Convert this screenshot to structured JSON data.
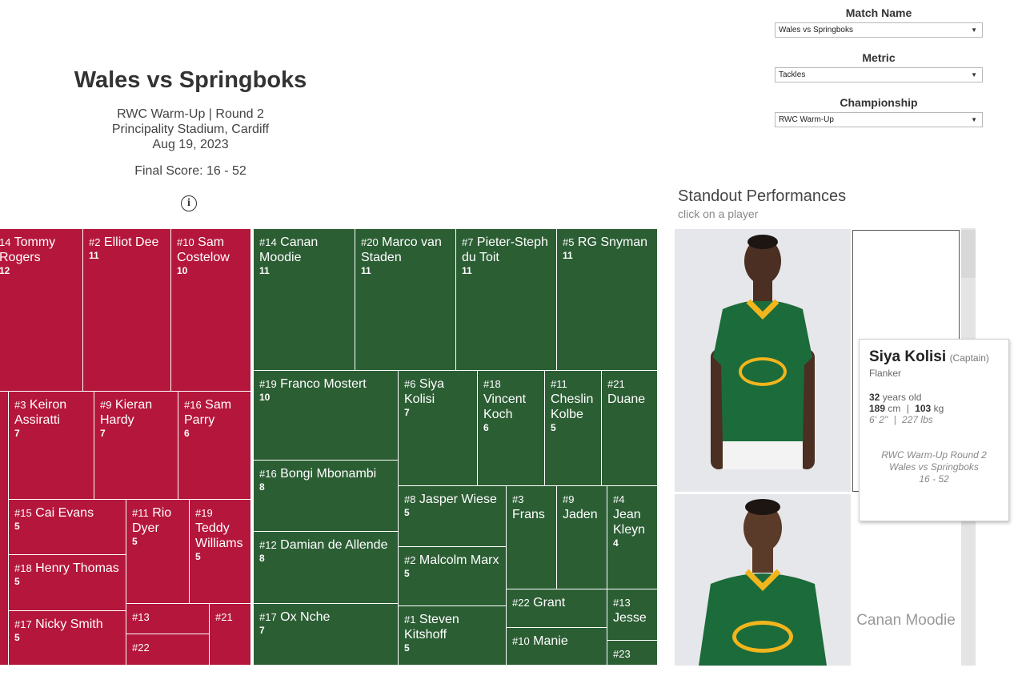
{
  "header": {
    "title": "Wales vs Springboks",
    "competition": "RWC Warm-Up | Round 2",
    "venue": "Principality Stadium, Cardiff",
    "date": "Aug 19, 2023",
    "final_score": "Final Score: 16 - 52",
    "info_icon": "i"
  },
  "filters": {
    "match_name": {
      "label": "Match Name",
      "value": "Wales vs Springboks"
    },
    "metric": {
      "label": "Metric",
      "value": "Tackles"
    },
    "championship": {
      "label": "Championship",
      "value": "RWC Warm-Up"
    }
  },
  "standout": {
    "title": "Standout Performances",
    "subtitle": "click on a player",
    "second_label": "Canan Moodie"
  },
  "colors": {
    "wales": "#b5163b",
    "springboks": "#2c5e34",
    "jersey": "#1c6b3b",
    "collar": "#f2b51c"
  },
  "wales_tiles": [
    {
      "num": "14",
      "name": "Tommy Rogers",
      "value": "12"
    },
    {
      "num": "#2",
      "name": "Elliot Dee",
      "value": "11"
    },
    {
      "num": "#10",
      "name": "Sam Costelow",
      "value": "10"
    },
    {
      "num": "#3",
      "name": "Keiron Assiratti",
      "value": "7"
    },
    {
      "num": "#9",
      "name": "Kieran Hardy",
      "value": "7"
    },
    {
      "num": "#16",
      "name": "Sam Parry",
      "value": "6"
    },
    {
      "num": "#15",
      "name": "Cai Evans",
      "value": "5"
    },
    {
      "num": "#11",
      "name": "Rio Dyer",
      "value": "5"
    },
    {
      "num": "#19",
      "name": "Teddy Williams",
      "value": "5"
    },
    {
      "num": "#18",
      "name": "Henry Thomas",
      "value": "5"
    },
    {
      "num": "#17",
      "name": "Nicky Smith",
      "value": "5"
    },
    {
      "num": "#13",
      "name": "",
      "value": ""
    },
    {
      "num": "#21",
      "name": "",
      "value": ""
    },
    {
      "num": "#22",
      "name": "",
      "value": ""
    },
    {
      "num": "",
      "name": "",
      "value": ""
    }
  ],
  "sa_tiles": [
    {
      "num": "#14",
      "name": "Canan Moodie",
      "value": "11"
    },
    {
      "num": "#20",
      "name": "Marco van Staden",
      "value": "11"
    },
    {
      "num": "#7",
      "name": "Pieter-Steph du Toit",
      "value": "11"
    },
    {
      "num": "#5",
      "name": "RG Snyman",
      "value": "11"
    },
    {
      "num": "#19",
      "name": "Franco Mostert",
      "value": "10"
    },
    {
      "num": "#6",
      "name": "Siya Kolisi",
      "value": "7"
    },
    {
      "num": "#18",
      "name": "Vincent Koch",
      "value": "6"
    },
    {
      "num": "#11",
      "name": "Cheslin Kolbe",
      "value": "5"
    },
    {
      "num": "#21",
      "name": "Duane",
      "value": ""
    },
    {
      "num": "#16",
      "name": "Bongi Mbonambi",
      "value": "8"
    },
    {
      "num": "#8",
      "name": "Jasper Wiese",
      "value": "5"
    },
    {
      "num": "#3",
      "name": "Frans",
      "value": ""
    },
    {
      "num": "#9",
      "name": "Jaden",
      "value": ""
    },
    {
      "num": "#4",
      "name": "Jean Kleyn",
      "value": "4"
    },
    {
      "num": "#12",
      "name": "Damian de Allende",
      "value": "8"
    },
    {
      "num": "#2",
      "name": "Malcolm Marx",
      "value": "5"
    },
    {
      "num": "#22",
      "name": "Grant",
      "value": ""
    },
    {
      "num": "#13",
      "name": "Jesse",
      "value": ""
    },
    {
      "num": "#17",
      "name": "Ox Nche",
      "value": "7"
    },
    {
      "num": "#1",
      "name": "Steven Kitshoff",
      "value": "5"
    },
    {
      "num": "#10",
      "name": "Manie",
      "value": ""
    },
    {
      "num": "#23",
      "name": "",
      "value": ""
    }
  ],
  "tooltip": {
    "name": "Siya Kolisi",
    "role": "(Captain)",
    "position": "Flanker",
    "age": "32",
    "age_label": "years old",
    "height_cm": "189",
    "cm_label": "cm",
    "weight_kg": "103",
    "kg_label": "kg",
    "sep": "|",
    "height_imperial": "6' 2\"",
    "weight_lbs": "227 lbs",
    "match_line1": "RWC Warm-Up Round 2",
    "match_line2": "Wales vs Springboks",
    "match_line3": "16 - 52"
  }
}
